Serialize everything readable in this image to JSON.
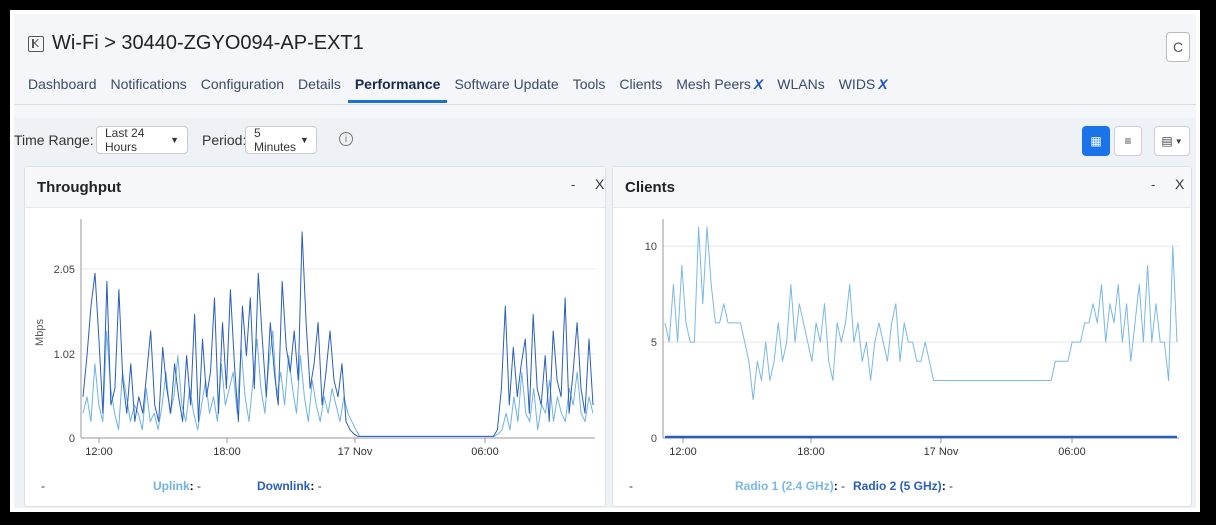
{
  "header": {
    "breadcrumb": "Wi-Fi > 30440-ZGYO094-AP-EXT1",
    "refresh_label": "C"
  },
  "tabs": [
    {
      "label": "Dashboard"
    },
    {
      "label": "Notifications"
    },
    {
      "label": "Configuration"
    },
    {
      "label": "Details"
    },
    {
      "label": "Performance",
      "active": true
    },
    {
      "label": "Software Update"
    },
    {
      "label": "Tools"
    },
    {
      "label": "Clients"
    },
    {
      "label": "Mesh Peers",
      "mark": "X"
    },
    {
      "label": "WLANs"
    },
    {
      "label": "WIDS",
      "mark": "X"
    }
  ],
  "controls": {
    "time_range_label": "Time Range:",
    "time_range_value": "Last 24 Hours",
    "period_label": "Period:",
    "period_value": "5 Minutes",
    "info_icon": "info-icon",
    "accent": "#1a73e8"
  },
  "panels": {
    "throughput": {
      "title": "Throughput",
      "minimize": "-",
      "close": "X"
    },
    "clients": {
      "title": "Clients",
      "minimize": "-",
      "close": "X"
    }
  },
  "chart_data": [
    {
      "type": "line",
      "title": "Throughput",
      "ylabel": "Mbps",
      "ylim": [
        0,
        2.56
      ],
      "yticks": [
        "0",
        "1.02",
        "2.05"
      ],
      "xticks": [
        "12:00",
        "18:00",
        "17 Nov",
        "06:00"
      ],
      "series": [
        {
          "name": "Uplink",
          "color": "#6fb2e4",
          "value_text": "-",
          "values": [
            0.3,
            0.5,
            0.2,
            0.9,
            0.4,
            0.2,
            1.3,
            0.6,
            0.3,
            0.1,
            0.8,
            0.5,
            0.2,
            0.4,
            0.3,
            0.1,
            0.6,
            0.2,
            0.3,
            0.1,
            0.4,
            0.8,
            0.3,
            0.5,
            1.0,
            0.4,
            0.2,
            0.6,
            0.3,
            0.1,
            0.4,
            0.7,
            0.3,
            0.5,
            0.2,
            0.9,
            0.4,
            0.6,
            0.8,
            0.3,
            1.1,
            0.5,
            0.2,
            0.7,
            1.2,
            0.6,
            0.3,
            0.9,
            1.3,
            0.5,
            0.8,
            0.4,
            1.0,
            0.6,
            0.3,
            1.0,
            0.5,
            0.2,
            0.7,
            0.4,
            0.2,
            0.5,
            0.3,
            0.6,
            0.4,
            0.2,
            0.5,
            0.3,
            0.2,
            0.1,
            0.02,
            0.02,
            0.02,
            0.02,
            0.02,
            0.02,
            0.02,
            0.02,
            0.02,
            0.02,
            0.02,
            0.02,
            0.02,
            0.02,
            0.02,
            0.02,
            0.02,
            0.02,
            0.02,
            0.02,
            0.02,
            0.02,
            0.02,
            0.02,
            0.02,
            0.02,
            0.02,
            0.02,
            0.02,
            0.02,
            0.02,
            0.02,
            0.02,
            0.02,
            0.02,
            0.05,
            0.1,
            0.3,
            0.1,
            0.5,
            0.2,
            0.8,
            0.3,
            0.2,
            0.6,
            0.1,
            0.4,
            0.3,
            0.7,
            0.2,
            0.5,
            0.3,
            0.2,
            0.6,
            0.4,
            0.8,
            0.3,
            0.2,
            0.5,
            0.3
          ]
        },
        {
          "name": "Downlink",
          "color": "#2a5fb8",
          "value_text": "-",
          "values": [
            0.5,
            1.0,
            1.6,
            2.0,
            1.2,
            0.3,
            1.9,
            0.4,
            0.6,
            1.8,
            0.7,
            0.3,
            0.9,
            0.2,
            0.5,
            0.3,
            0.8,
            1.3,
            0.4,
            0.2,
            1.1,
            0.6,
            0.3,
            0.9,
            0.5,
            0.2,
            1.0,
            0.4,
            1.5,
            0.2,
            1.2,
            0.5,
            0.8,
            1.7,
            0.3,
            1.4,
            0.6,
            1.8,
            0.9,
            0.2,
            1.6,
            1.0,
            1.7,
            0.6,
            2.0,
            1.2,
            0.5,
            1.4,
            0.8,
            0.4,
            1.9,
            1.1,
            0.8,
            1.3,
            0.7,
            2.5,
            1.4,
            0.6,
            0.9,
            1.4,
            0.4,
            0.8,
            1.3,
            0.7,
            0.5,
            0.9,
            0.2,
            0.1,
            0.05,
            0.02,
            0.02,
            0.02,
            0.02,
            0.02,
            0.02,
            0.02,
            0.02,
            0.02,
            0.02,
            0.02,
            0.02,
            0.02,
            0.02,
            0.02,
            0.02,
            0.02,
            0.02,
            0.02,
            0.02,
            0.02,
            0.02,
            0.02,
            0.02,
            0.02,
            0.02,
            0.02,
            0.02,
            0.02,
            0.02,
            0.02,
            0.02,
            0.02,
            0.02,
            0.02,
            0.1,
            0.6,
            1.6,
            0.4,
            1.1,
            0.5,
            0.9,
            1.2,
            0.3,
            1.5,
            0.6,
            0.4,
            1.0,
            0.2,
            1.3,
            0.7,
            0.5,
            1.7,
            0.3,
            0.8,
            1.4,
            0.6,
            0.3,
            1.2,
            0.4
          ]
        }
      ]
    },
    {
      "type": "line",
      "title": "Clients",
      "ylim": [
        0,
        11
      ],
      "yticks": [
        "0",
        "5",
        "10"
      ],
      "xticks": [
        "12:00",
        "18:00",
        "17 Nov",
        "06:00"
      ],
      "series": [
        {
          "name": "Radio 1 (2.4 GHz)",
          "color": "#7ab8e6",
          "value_text": "-",
          "values": [
            6,
            5,
            8,
            5,
            9,
            6,
            5,
            5,
            11,
            7,
            11,
            8,
            6,
            6,
            7,
            6,
            6,
            6,
            6,
            5,
            4,
            2,
            4,
            3,
            5,
            3,
            4,
            6,
            4,
            5,
            8,
            5,
            7,
            6,
            5,
            4,
            6,
            5,
            7,
            4,
            3,
            6,
            5,
            6,
            8,
            5,
            6,
            4,
            5,
            3,
            5,
            6,
            5,
            4,
            6,
            7,
            4,
            6,
            5,
            5,
            4,
            4,
            5,
            4,
            3,
            3,
            3,
            3,
            3,
            3,
            3,
            3,
            3,
            3,
            3,
            3,
            3,
            3,
            3,
            3,
            3,
            3,
            3,
            3,
            3,
            3,
            3,
            3,
            3,
            3,
            3,
            3,
            3,
            4,
            4,
            4,
            4,
            5,
            5,
            5,
            6,
            6,
            7,
            6,
            8,
            5,
            7,
            6,
            8,
            5,
            7,
            4,
            6,
            8,
            5,
            9,
            5,
            7,
            5,
            5,
            3,
            10,
            5
          ]
        },
        {
          "name": "Radio 2 (5 GHz)",
          "color": "#2a5fb8",
          "value_text": "-",
          "values": [
            0.05,
            0.05
          ]
        }
      ]
    }
  ]
}
